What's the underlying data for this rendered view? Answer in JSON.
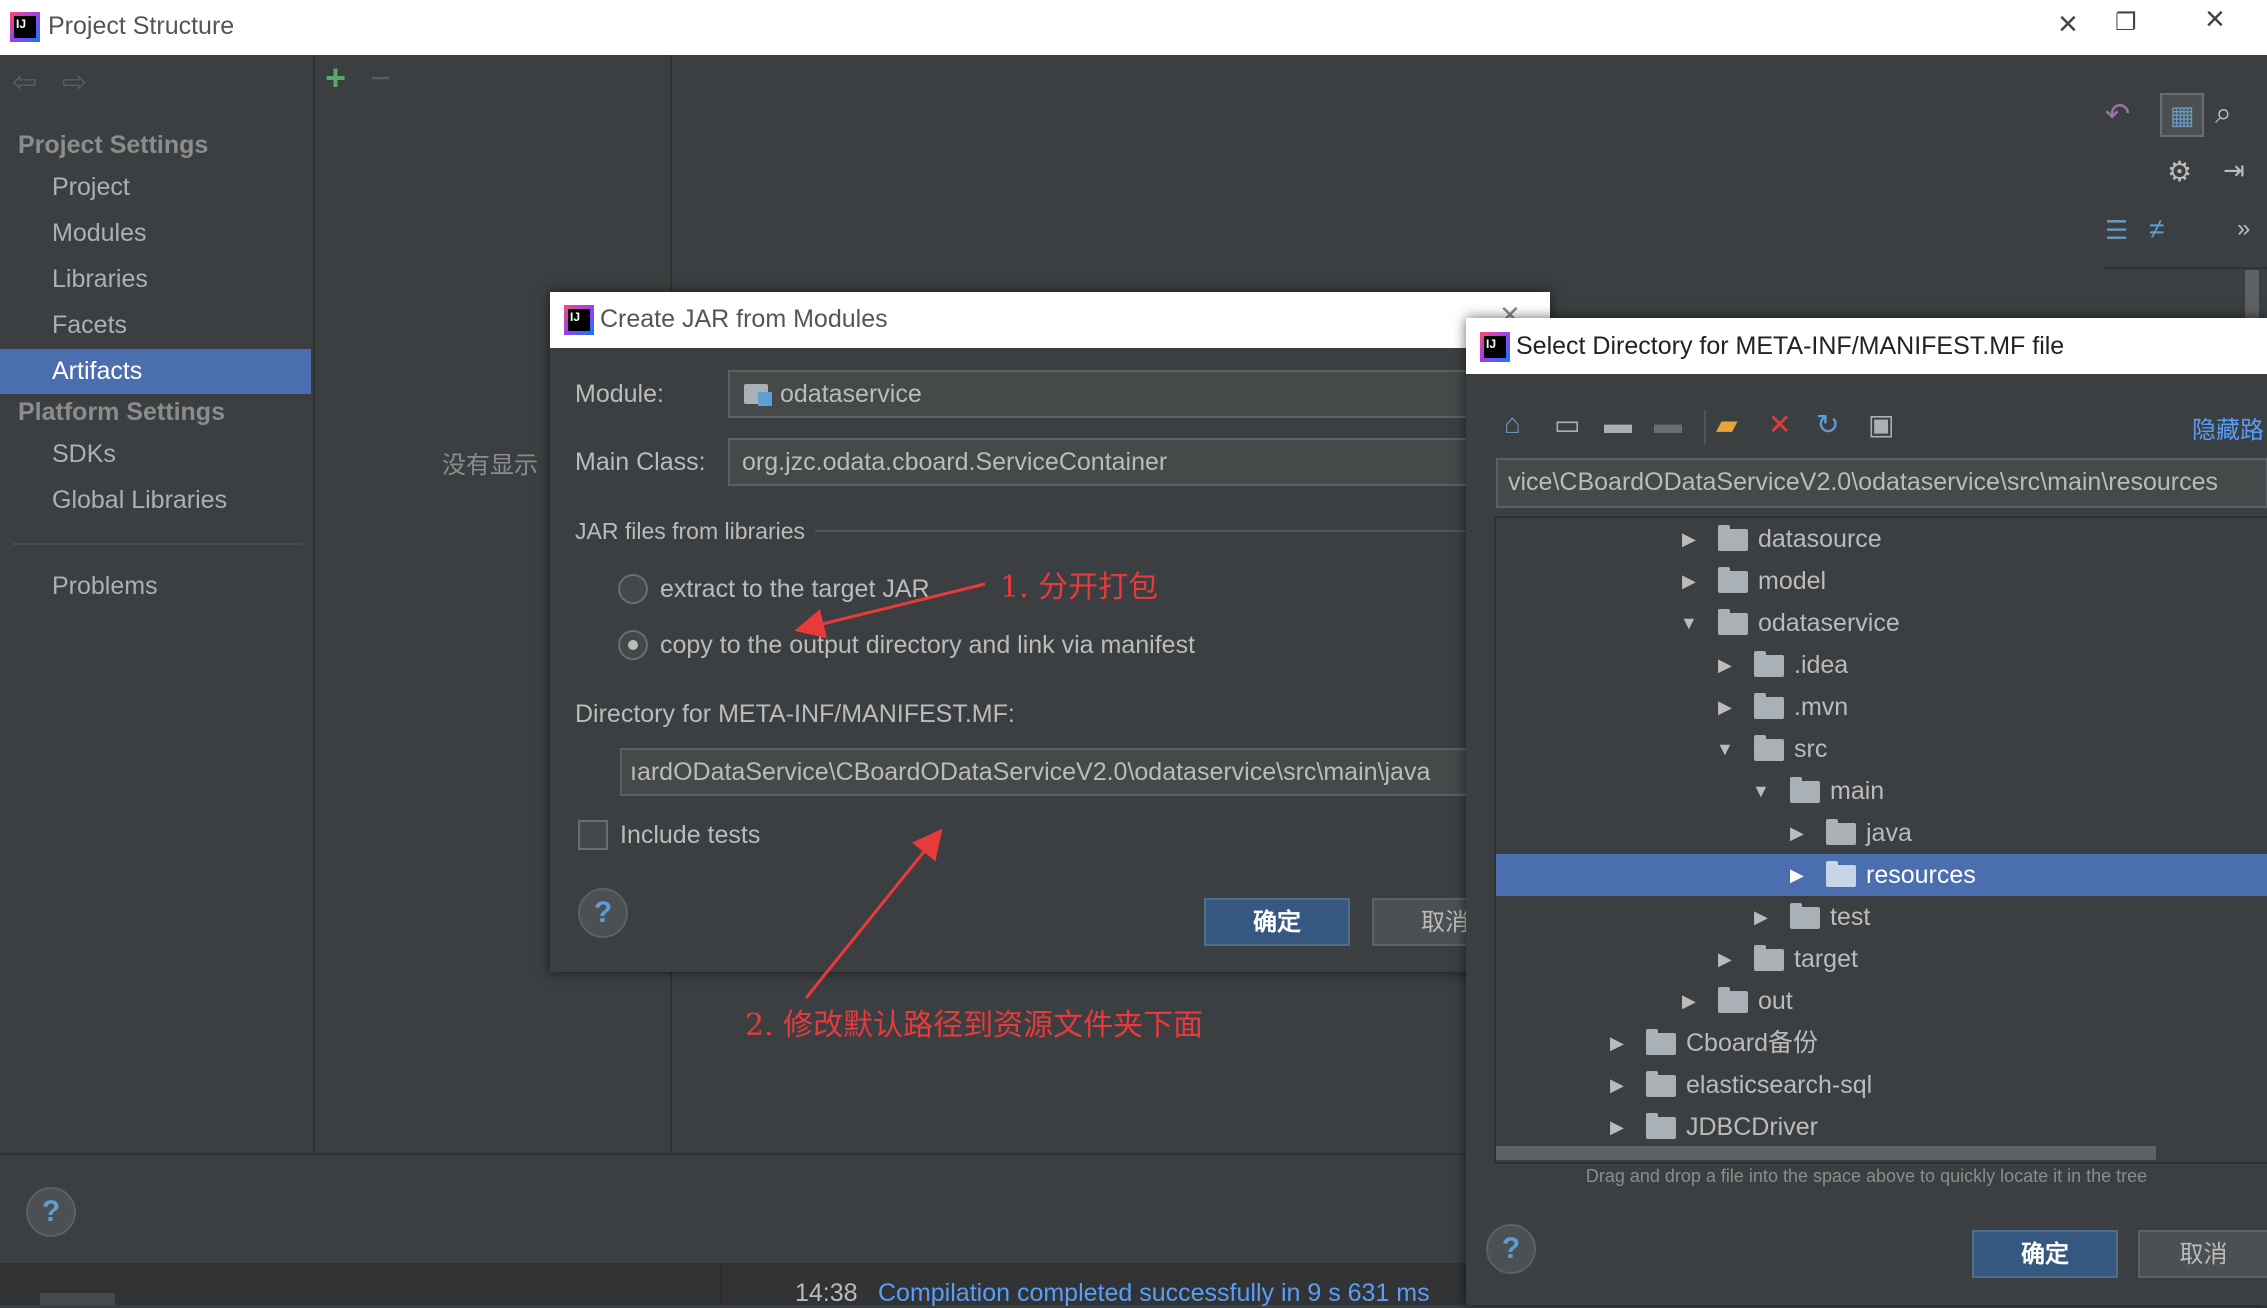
{
  "project_structure": {
    "title": "Project Structure",
    "project_settings_header": "Project Settings",
    "project_settings_items": [
      "Project",
      "Modules",
      "Libraries",
      "Facets",
      "Artifacts"
    ],
    "selected_item": "Artifacts",
    "platform_settings_header": "Platform Settings",
    "platform_settings_items": [
      "SDKs",
      "Global Libraries"
    ],
    "problems_label": "Problems",
    "add_label": "+",
    "remove_label": "−",
    "nothing_to_show": "没有显示"
  },
  "status_bar": {
    "time": "14:38",
    "message": "Compilation completed successfully in 9 s 631 ms"
  },
  "jar_dialog": {
    "title": "Create JAR from Modules",
    "module_label": "Module:",
    "module_value": "odataservice",
    "main_class_label": "Main Class:",
    "main_class_value": "org.jzc.odata.cboard.ServiceContainer",
    "jar_files_group": "JAR files from libraries",
    "option_extract": "extract to the target JAR",
    "option_copy": "copy to the output directory and link via manifest",
    "selected_option": "copy",
    "manifest_dir_label": "Directory for META-INF/MANIFEST.MF:",
    "manifest_dir_value": "ıardODataService\\CBoardODataServiceV2.0\\odataservice\\src\\main\\java",
    "include_tests_label": "Include tests",
    "include_tests_checked": false,
    "ok_label": "确定",
    "cancel_label": "取消"
  },
  "dir_dialog": {
    "title": "Select Directory for META-INF/MANIFEST.MF file",
    "hide_path_label": "隐藏路",
    "path_value": "vice\\CBoardODataServiceV2.0\\odataservice\\src\\main\\resources",
    "tree": [
      {
        "label": "datasource",
        "expanded": false
      },
      {
        "label": "model",
        "expanded": false
      },
      {
        "label": "odataservice",
        "expanded": true
      },
      {
        "label": ".idea",
        "expanded": false
      },
      {
        "label": ".mvn",
        "expanded": false
      },
      {
        "label": "src",
        "expanded": true
      },
      {
        "label": "main",
        "expanded": true
      },
      {
        "label": "java",
        "expanded": false
      },
      {
        "label": "resources",
        "expanded": false,
        "selected": true
      },
      {
        "label": "test",
        "expanded": false
      },
      {
        "label": "target",
        "expanded": false
      },
      {
        "label": "out",
        "expanded": false
      },
      {
        "label": "Cboard备份",
        "expanded": false
      },
      {
        "label": "elasticsearch-sql",
        "expanded": false
      },
      {
        "label": "JDBCDriver",
        "expanded": false
      }
    ],
    "hint": "Drag and drop a file into the space above to quickly locate it in the tree",
    "ok_label": "确定",
    "cancel_label": "取消"
  },
  "annotations": {
    "step1": "1. 分开打包",
    "step2": "2. 修改默认路径到资源文件夹下面"
  },
  "colors": {
    "ide_background": "#3c3f41",
    "selection": "#4b6eaf",
    "primary_button": "#365880",
    "annotation": "#e83a3a",
    "status_link": "#589df6"
  }
}
